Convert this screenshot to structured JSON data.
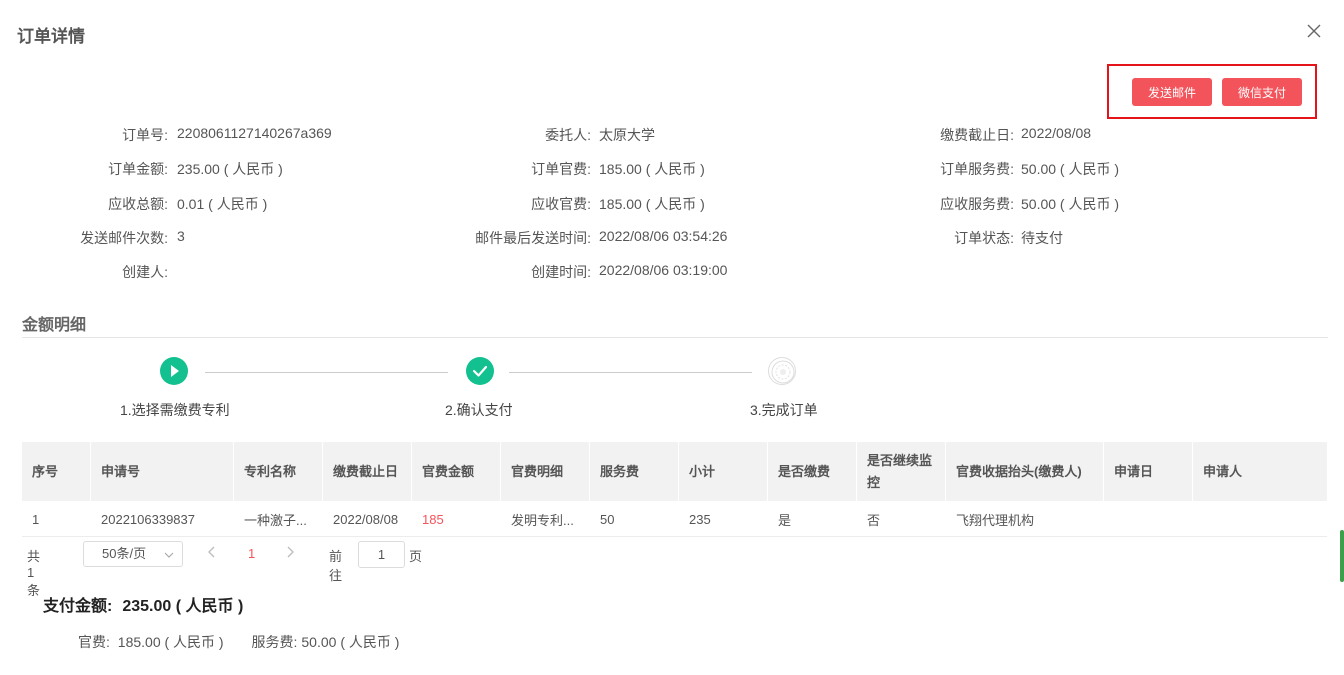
{
  "dialog": {
    "title": "订单详情"
  },
  "actions": {
    "send_email": "发送邮件",
    "wechat_pay": "微信支付"
  },
  "info": {
    "order_no": {
      "label": "订单号:",
      "value": "2208061127140267a369"
    },
    "client": {
      "label": "委托人:",
      "value": "太原大学"
    },
    "pay_deadline": {
      "label": "缴费截止日:",
      "value": "2022/08/08"
    },
    "order_amount": {
      "label": "订单金额:",
      "value": "235.00 ( 人民币 )"
    },
    "order_official_fee": {
      "label": "订单官费:",
      "value": "185.00 ( 人民币 )"
    },
    "order_service_fee": {
      "label": "订单服务费:",
      "value": "50.00 ( 人民币 )"
    },
    "receivable_total": {
      "label": "应收总额:",
      "value": "0.01 ( 人民币 )"
    },
    "receivable_official": {
      "label": "应收官费:",
      "value": "185.00 ( 人民币 )"
    },
    "receivable_service": {
      "label": "应收服务费:",
      "value": "50.00 ( 人民币 )"
    },
    "email_count": {
      "label": "发送邮件次数:",
      "value": "3"
    },
    "email_last_time": {
      "label": "邮件最后发送时间:",
      "value": "2022/08/06 03:54:26"
    },
    "order_status": {
      "label": "订单状态:",
      "value": "待支付"
    },
    "creator": {
      "label": "创建人:",
      "value": ""
    },
    "created_time": {
      "label": "创建时间:",
      "value": "2022/08/06 03:19:00"
    }
  },
  "section": {
    "title": "金额明细"
  },
  "steps": [
    {
      "label": "1.选择需缴费专利",
      "status": "done",
      "icon": "play-icon"
    },
    {
      "label": "2.确认支付",
      "status": "done",
      "icon": "check-icon"
    },
    {
      "label": "3.完成订单",
      "status": "todo",
      "icon": "seal-icon"
    }
  ],
  "table": {
    "headers": [
      "序号",
      "申请号",
      "专利名称",
      "缴费截止日",
      "官费金额",
      "官费明细",
      "服务费",
      "小计",
      "是否缴费",
      "是否继续监控",
      "官费收据抬头(缴费人)",
      "申请日",
      "申请人"
    ],
    "rows": [
      [
        "1",
        "2022106339837",
        "一种激子...",
        "2022/08/08",
        "185",
        "发明专利...",
        "50",
        "235",
        "是",
        "否",
        "飞翔代理机构",
        "",
        ""
      ]
    ]
  },
  "pager": {
    "total": "共 1 条",
    "page_size": "50条/页",
    "current": "1",
    "goto_label": "前往",
    "goto_value": "1",
    "page_suffix": "页"
  },
  "payment": {
    "total_label": "支付金额:",
    "total_value": "235.00 ( 人民币 )",
    "official_label": "官费:",
    "official_value": "185.00 ( 人民币 )",
    "service_label": "服务费:",
    "service_value": "50.00 ( 人民币 )"
  },
  "colors": {
    "accent_red": "#f3545b",
    "highlight_border": "#e4141a",
    "step_green": "#13c08f"
  }
}
